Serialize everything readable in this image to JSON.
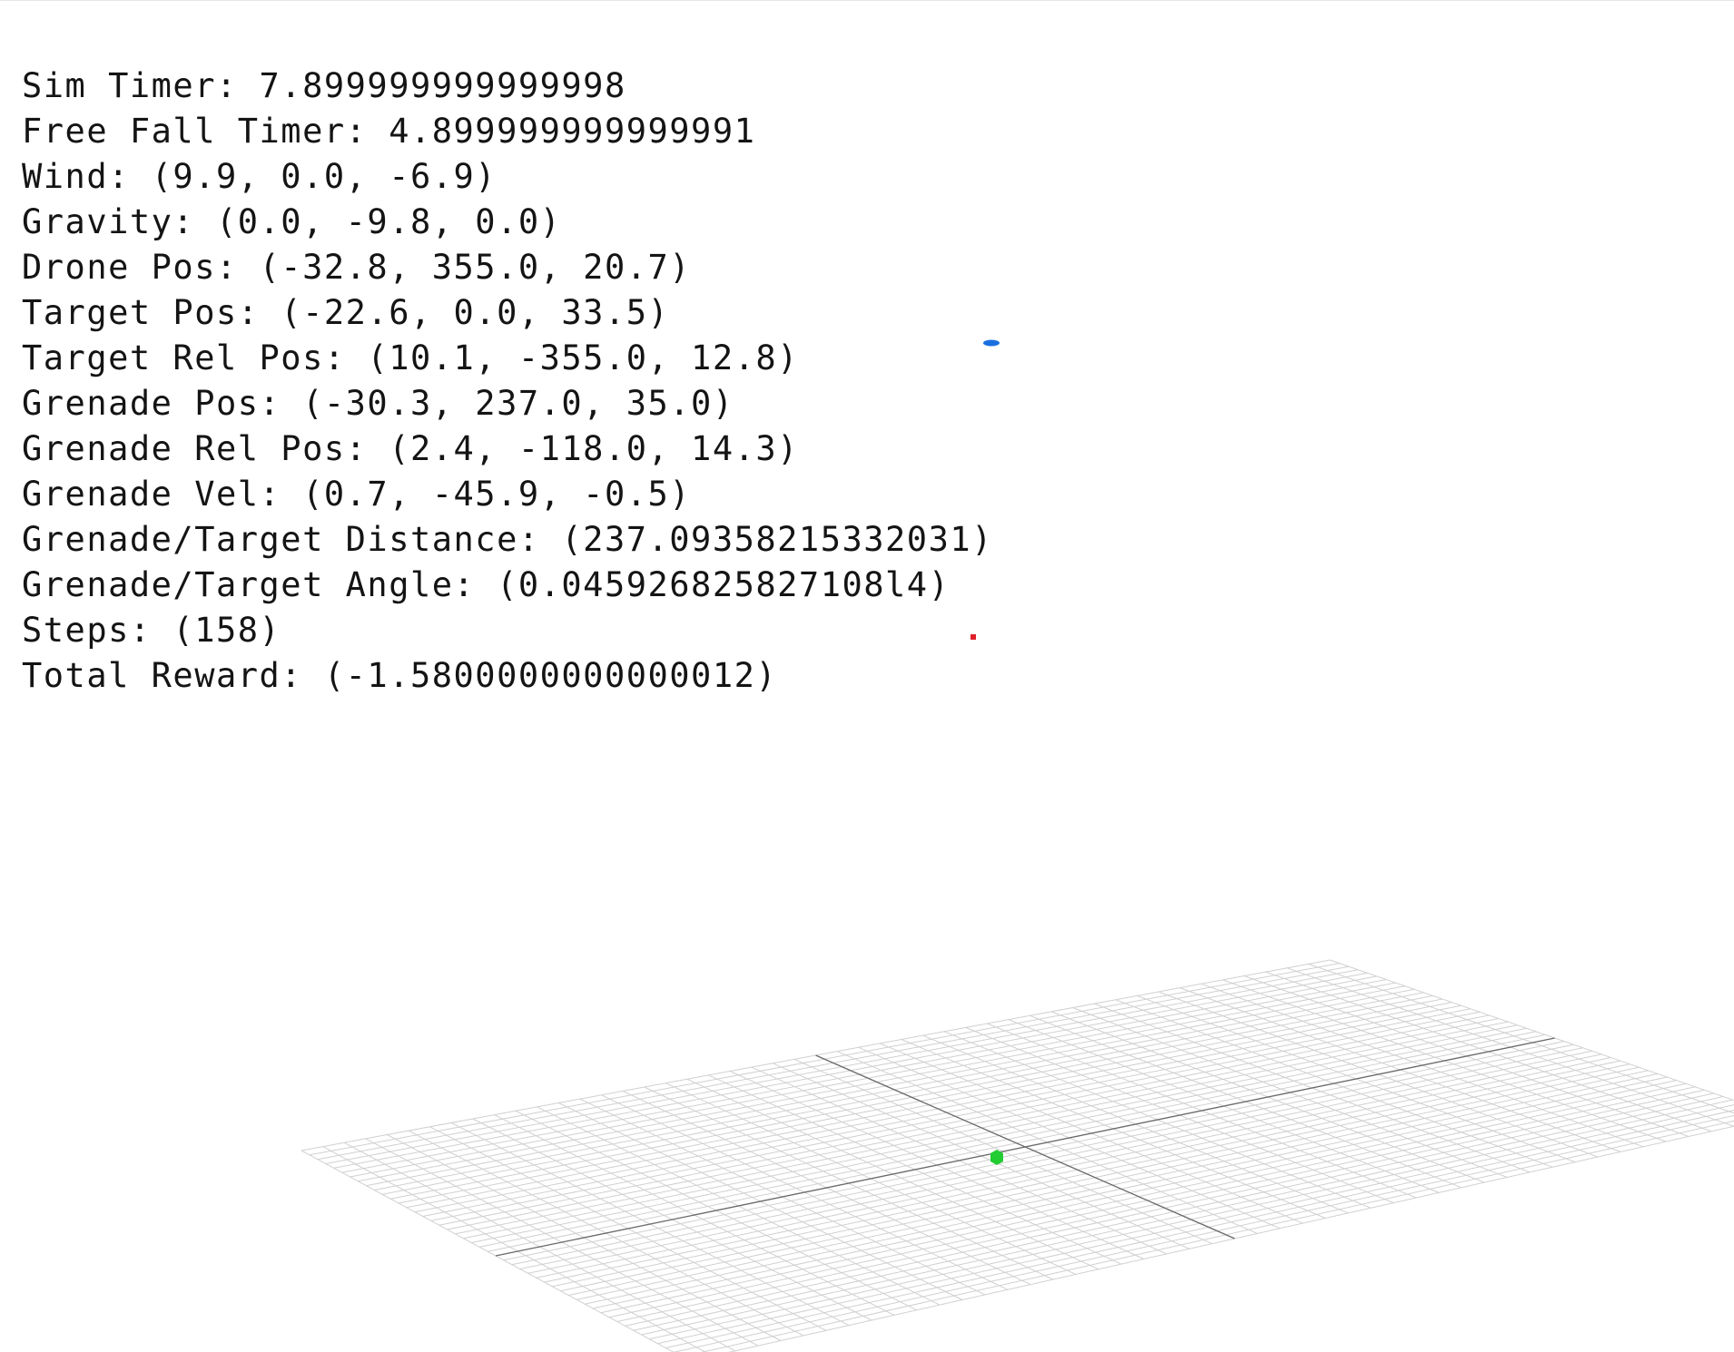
{
  "hud": {
    "lines": [
      "Sim Timer: 7.899999999999998",
      "Free Fall Timer: 4.899999999999991",
      "Wind: (9.9, 0.0, -6.9)",
      "Gravity: (0.0, -9.8, 0.0)",
      "Drone Pos: (-32.8, 355.0, 20.7)",
      "Target Pos: (-22.6, 0.0, 33.5)",
      "Target Rel Pos: (10.1, -355.0, 12.8)",
      "Grenade Pos: (-30.3, 237.0, 35.0)",
      "Grenade Rel Pos: (2.4, -118.0, 14.3)",
      "Grenade Vel: (0.7, -45.9, -0.5)",
      "Grenade/Target Distance: (237.09358215332031)",
      "Grenade/Target Angle: (0.045926825827108l4)",
      "Steps: (158)",
      "Total Reward: (-1.5800000000000012)"
    ]
  },
  "scene": {
    "drone_marker": {
      "icon": "drone-marker-icon",
      "color": "#1a6fe0"
    },
    "grenade_marker": {
      "icon": "grenade-marker-icon",
      "color": "#e0202a"
    },
    "target_marker": {
      "icon": "target-marker-icon",
      "color": "#22cc33"
    },
    "ground_grid": {
      "minor_color": "#d0d0d0",
      "axis_color": "#6a6a6a"
    }
  }
}
